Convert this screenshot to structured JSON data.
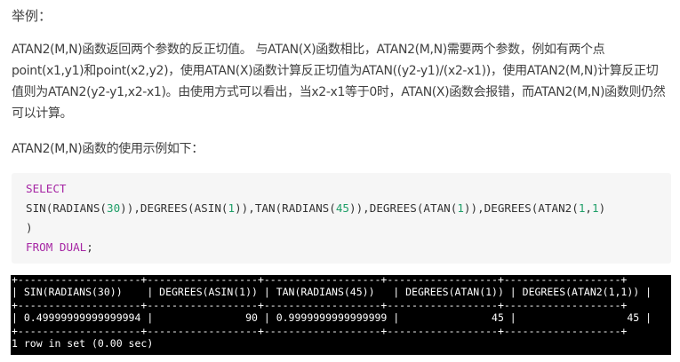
{
  "heading": "举例：",
  "paragraph1": "ATAN2(M,N)函数返回两个参数的反正切值。 与ATAN(X)函数相比，ATAN2(M,N)需要两个参数，例如有两个点point(x1,y1)和point(x2,y2)，使用ATAN(X)函数计算反正切值为ATAN((y2-y1)/(x2-x1))，使用ATAN2(M,N)计算反正切值则为ATAN2(y2-y1,x2-x1)。由使用方式可以看出，当x2-x1等于0时，ATAN(X)函数会报错，而ATAN2(M,N)函数则仍然可以计算。",
  "paragraph2": "ATAN2(M,N)函数的使用示例如下：",
  "code": {
    "select_kw": "SELECT",
    "fn_line": [
      {
        "t": "SIN(RADIANS(",
        "k": "p"
      },
      {
        "t": "30",
        "k": "n"
      },
      {
        "t": ")),DEGREES(ASIN(",
        "k": "p"
      },
      {
        "t": "1",
        "k": "n"
      },
      {
        "t": ")),TAN(RADIANS(",
        "k": "p"
      },
      {
        "t": "45",
        "k": "n"
      },
      {
        "t": ")),DEGREES(ATAN(",
        "k": "p"
      },
      {
        "t": "1",
        "k": "n"
      },
      {
        "t": ")),DEGREES(ATAN2(",
        "k": "p"
      },
      {
        "t": "1",
        "k": "n"
      },
      {
        "t": ",",
        "k": "p"
      },
      {
        "t": "1",
        "k": "n"
      },
      {
        "t": ")",
        "k": "p"
      }
    ],
    "close_paren": ")",
    "from_kw": "FROM DUAL",
    "semicolon": ";"
  },
  "terminal": {
    "border": "+--------------------+------------------+-------------------+------------------+-------------------+",
    "header": "| SIN(RADIANS(30))    | DEGREES(ASIN(1)) | TAN(RADIANS(45))   | DEGREES(ATAN(1)) | DEGREES(ATAN2(1,1)) |",
    "row": "| 0.49999999999999994 |               90 | 0.9999999999999999 |               45 |                  45 |",
    "footer": "1 row in set (0.00 sec)"
  }
}
